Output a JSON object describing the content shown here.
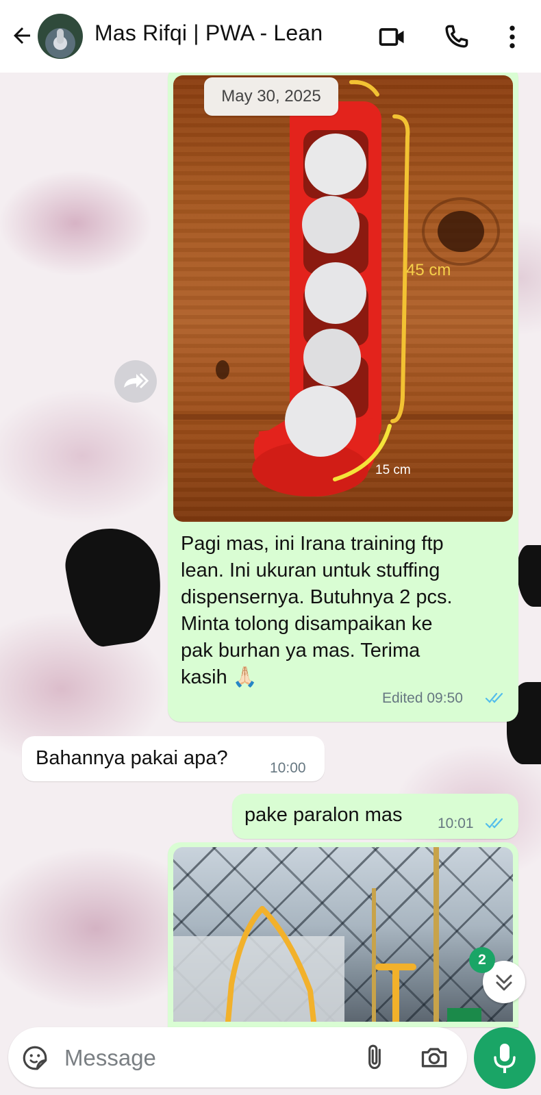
{
  "header": {
    "contact_name": "Mas Rifqi | PWA - Lean"
  },
  "chat": {
    "date_chip": "May 30, 2025",
    "photo1": {
      "annotation_height": "45 cm",
      "annotation_width": "15 cm"
    },
    "messages": [
      {
        "direction": "outgoing",
        "lines": [
          "Pagi mas, ini Irana training ftp",
          "lean. Ini ukuran untuk stuffing",
          "dispensernya. Butuhnya 2 pcs.",
          "Minta tolong disampaikan ke",
          "pak burhan ya mas. Terima",
          "kasih 🙏🏻"
        ],
        "meta": "Edited 09:50",
        "status": "read"
      },
      {
        "direction": "incoming",
        "text": "Bahannya pakai apa?",
        "time": "10:00"
      },
      {
        "direction": "outgoing",
        "text": "pake paralon mas",
        "time": "10:01",
        "status": "read"
      }
    ],
    "unread_count": "2"
  },
  "composer": {
    "placeholder": "Message"
  },
  "colors": {
    "accent": "#1aa566",
    "outgoing_bubble": "#d9fdd3",
    "read_ticks": "#53bdeb"
  },
  "icons": [
    "back-arrow-icon",
    "video-call-icon",
    "phone-icon",
    "more-vert-icon",
    "forward-icon",
    "chevron-double-down-icon",
    "sticker-icon",
    "attach-icon",
    "camera-icon",
    "mic-icon"
  ]
}
